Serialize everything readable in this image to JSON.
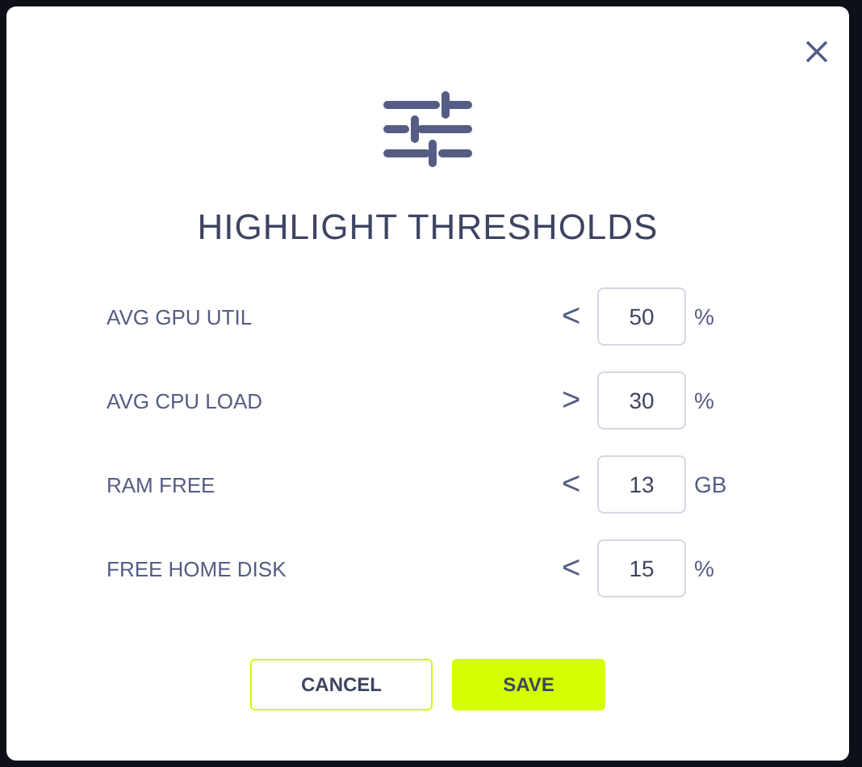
{
  "dialog": {
    "title": "HIGHLIGHT THRESHOLDS",
    "thresholds": [
      {
        "label": "AVG GPU UTIL",
        "operator": "<",
        "value": "50",
        "unit": "%"
      },
      {
        "label": "AVG CPU LOAD",
        "operator": ">",
        "value": "30",
        "unit": "%"
      },
      {
        "label": "RAM FREE",
        "operator": "<",
        "value": "13",
        "unit": "GB"
      },
      {
        "label": "FREE HOME DISK",
        "operator": "<",
        "value": "15",
        "unit": "%"
      }
    ],
    "buttons": [
      {
        "label": "CANCEL",
        "kind": "secondary"
      },
      {
        "label": "SAVE",
        "kind": "primary"
      }
    ]
  }
}
